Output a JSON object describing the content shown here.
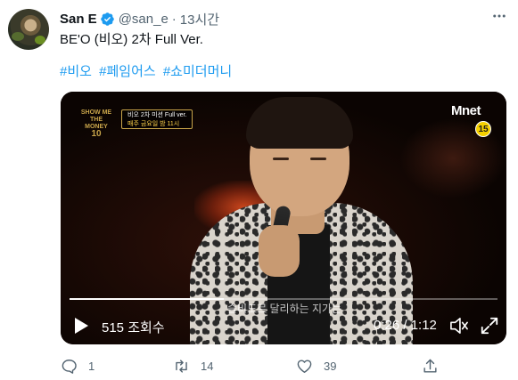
{
  "tweet": {
    "author_name": "San E",
    "handle": "@san_e",
    "separator": "·",
    "time_ago": "13시간",
    "more_icon": "ellipsis-icon",
    "text": "BE'O (비오) 2차 Full Ver.",
    "hashtags": [
      "#비오",
      "#페임어스",
      "#쇼미더머니"
    ]
  },
  "video": {
    "show_logo_line1": "SHOW ME",
    "show_logo_line2": "THE MONEY",
    "show_logo_line3": "10",
    "banner_line1": "비오 2차 미션 Full ver.",
    "banner_line2": "매주 금요일 밤 11시",
    "channel": "Mnet",
    "age_rating": "15",
    "subtitle": "슬비도르 달리하는 지가는",
    "views": "515 조회수",
    "time": "0:26 / 1:12",
    "progress": 0.36
  },
  "actions": {
    "reply_count": "1",
    "retweet_count": "14",
    "like_count": "39"
  },
  "colors": {
    "link": "#1d9bf0",
    "muted": "#536471",
    "verified": "#1d9bf0"
  }
}
